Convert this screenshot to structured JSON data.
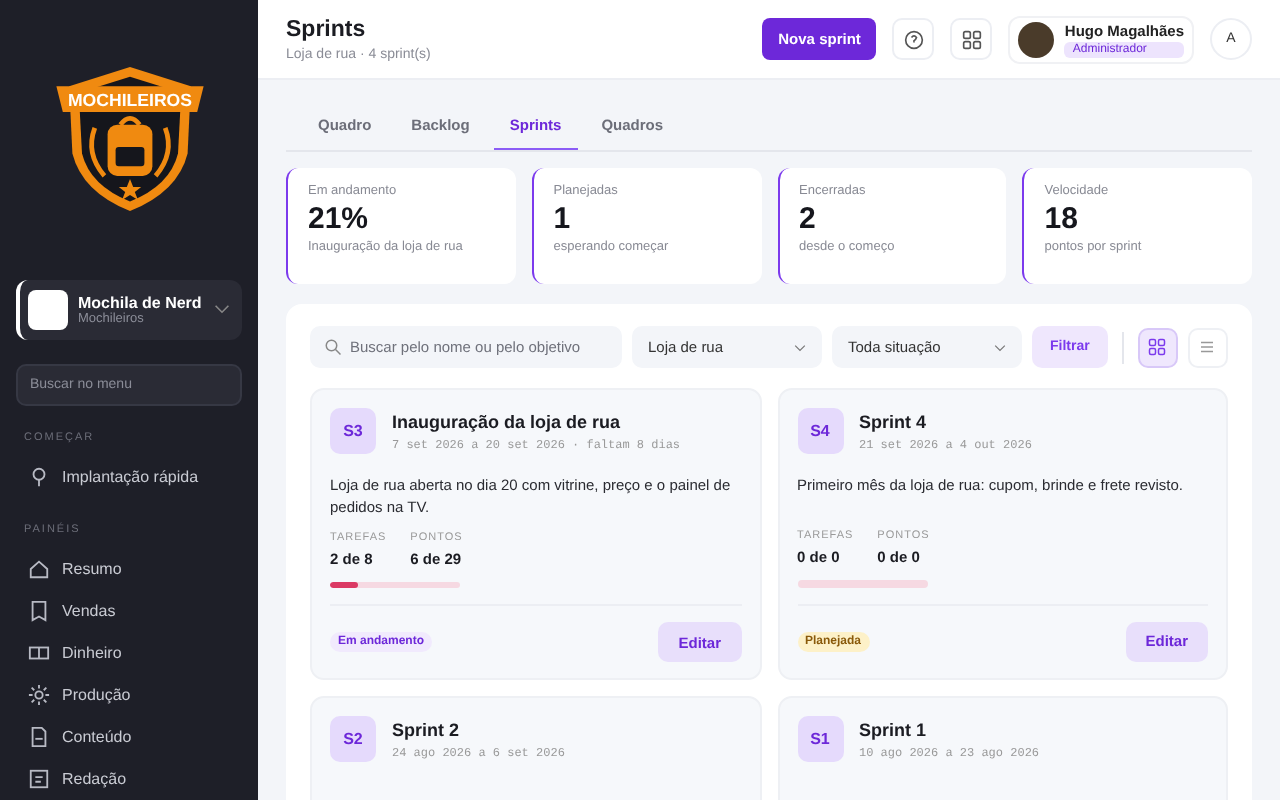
{
  "sidebar": {
    "logo_text": "MOCHILEIROS",
    "workspace": {
      "name": "Mochila de Nerd",
      "subtitle": "Mochileiros"
    },
    "search": {
      "placeholder": "Buscar no menu"
    },
    "sections": [
      {
        "title": "COMEÇAR",
        "items": [
          {
            "label": "Implantação rápida"
          }
        ]
      },
      {
        "title": "PAINÉIS",
        "items": [
          {
            "label": "Resumo"
          },
          {
            "label": "Vendas"
          },
          {
            "label": "Dinheiro"
          },
          {
            "label": "Produção"
          },
          {
            "label": "Conteúdo"
          },
          {
            "label": "Redação"
          }
        ]
      }
    ]
  },
  "header": {
    "title": "Sprints",
    "subtitle": "Loja de rua · 4 sprint(s)",
    "primary_button": "Nova sprint",
    "user": {
      "name": "Hugo Magalhães",
      "role": "Administrador"
    },
    "avatar_letter": "A"
  },
  "tabs": [
    {
      "label": "Quadro",
      "selected": false
    },
    {
      "label": "Backlog",
      "selected": false
    },
    {
      "label": "Sprints",
      "selected": true
    },
    {
      "label": "Quadros",
      "selected": false
    }
  ],
  "stats": [
    {
      "label": "Em andamento",
      "value": "21%",
      "note": "Inauguração da loja de rua"
    },
    {
      "label": "Planejadas",
      "value": "1",
      "note": "esperando começar"
    },
    {
      "label": "Encerradas",
      "value": "2",
      "note": "desde o começo"
    },
    {
      "label": "Velocidade",
      "value": "18",
      "note": "pontos por sprint"
    }
  ],
  "filters": {
    "search": {
      "placeholder": "Buscar pelo nome ou pelo objetivo"
    },
    "project": "Loja de rua",
    "status": "Toda situação",
    "button": "Filtrar",
    "view_buttons": [
      {
        "selected": true
      },
      {
        "selected": false
      }
    ]
  },
  "sprints": [
    {
      "code": "S3",
      "name": "Inauguração da loja de rua",
      "dates": "7 set 2026 a 20 set 2026 · faltam 8 dias",
      "goal": "Loja de rua aberta no dia 20 com vitrine, preço e o painel de pedidos na TV.",
      "tasks_label": "TAREFAS",
      "tasks": "2 de 8",
      "points_label": "PONTOS",
      "points": "6 de 29",
      "level": 0.21,
      "status": "Em andamento",
      "kind": "active",
      "edit": "Editar"
    },
    {
      "code": "S4",
      "name": "Sprint 4",
      "dates": "21 set 2026 a 4 out 2026",
      "goal": "Primeiro mês da loja de rua: cupom, brinde e frete revisto.",
      "tasks_label": "TAREFAS",
      "tasks": "0 de 0",
      "points_label": "PONTOS",
      "points": "0 de 0",
      "level": 0,
      "status": "Planejada",
      "kind": "planned",
      "edit": "Editar"
    },
    {
      "code": "S2",
      "name": "Sprint 2",
      "dates": "24 ago 2026 a 6 set 2026"
    },
    {
      "code": "S1",
      "name": "Sprint 1",
      "dates": "10 ago 2026 a 23 ago 2026"
    }
  ]
}
